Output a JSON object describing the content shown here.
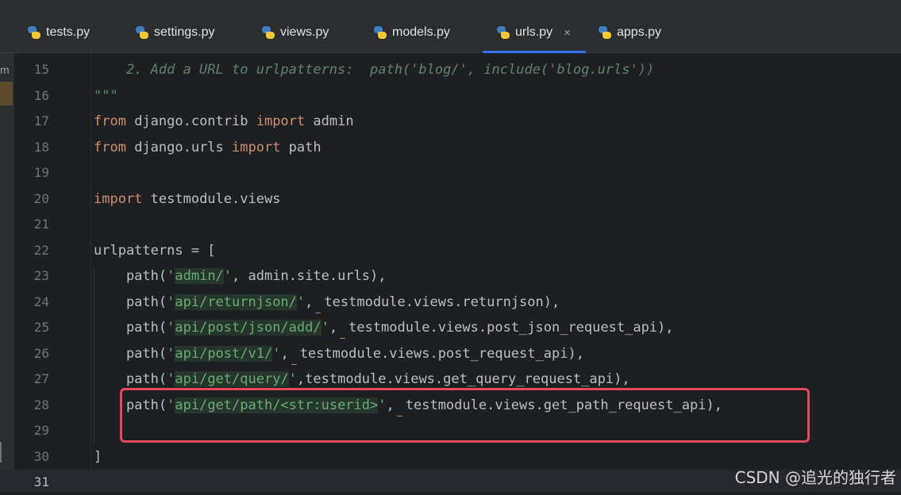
{
  "tabs": [
    {
      "label": "tests.py",
      "icon": "python-file-icon",
      "active": false
    },
    {
      "label": "settings.py",
      "icon": "python-file-icon",
      "active": false
    },
    {
      "label": "views.py",
      "icon": "python-file-icon",
      "active": false
    },
    {
      "label": "models.py",
      "icon": "python-file-icon",
      "active": false
    },
    {
      "label": "urls.py",
      "icon": "python-file-icon",
      "active": true
    },
    {
      "label": "apps.py",
      "icon": "python-file-icon",
      "active": false
    }
  ],
  "tab_close_glyph": "×",
  "left_strip_label": "m",
  "lines": [
    {
      "n": "15",
      "tokens": [
        {
          "t": "    2. Add a URL to urlpatterns:  path('blog/', include('blog.urls'))",
          "c": "cm"
        }
      ]
    },
    {
      "n": "16",
      "tokens": [
        {
          "t": "\"\"\"",
          "c": "cm"
        }
      ]
    },
    {
      "n": "17",
      "tokens": [
        {
          "t": "from",
          "c": "kw"
        },
        {
          "t": " django.contrib ",
          "c": ""
        },
        {
          "t": "import",
          "c": "kw"
        },
        {
          "t": " admin",
          "c": ""
        }
      ]
    },
    {
      "n": "18",
      "tokens": [
        {
          "t": "from",
          "c": "kw"
        },
        {
          "t": " django.urls ",
          "c": ""
        },
        {
          "t": "import",
          "c": "kw"
        },
        {
          "t": " path",
          "c": ""
        }
      ]
    },
    {
      "n": "19",
      "tokens": []
    },
    {
      "n": "20",
      "tokens": [
        {
          "t": "import",
          "c": "kw"
        },
        {
          "t": " testmodule.views",
          "c": ""
        }
      ]
    },
    {
      "n": "21",
      "tokens": []
    },
    {
      "n": "22",
      "tokens": [
        {
          "t": "urlpatterns = [",
          "c": ""
        }
      ]
    },
    {
      "n": "23",
      "tokens": [
        {
          "t": "    path(",
          "c": ""
        },
        {
          "t": "'",
          "c": "str"
        },
        {
          "t": "admin/",
          "c": "strhl"
        },
        {
          "t": "'",
          "c": "str"
        },
        {
          "t": ", admin.site.urls),",
          "c": ""
        }
      ]
    },
    {
      "n": "24",
      "tokens": [
        {
          "t": "    path(",
          "c": ""
        },
        {
          "t": "'",
          "c": "str"
        },
        {
          "t": "api/returnjson/",
          "c": "strhl"
        },
        {
          "t": "'",
          "c": "str"
        },
        {
          "t": ",",
          "c": "ws"
        },
        {
          "t": "testmodule.views.returnjson),",
          "c": ""
        }
      ]
    },
    {
      "n": "25",
      "tokens": [
        {
          "t": "    path(",
          "c": ""
        },
        {
          "t": "'",
          "c": "str"
        },
        {
          "t": "api/post/json/add/",
          "c": "strhl"
        },
        {
          "t": "'",
          "c": "str"
        },
        {
          "t": ",",
          "c": "ws"
        },
        {
          "t": "testmodule.views.post_json_request_api),",
          "c": ""
        }
      ]
    },
    {
      "n": "26",
      "tokens": [
        {
          "t": "    path(",
          "c": ""
        },
        {
          "t": "'",
          "c": "str"
        },
        {
          "t": "api/post/v1/",
          "c": "strhl"
        },
        {
          "t": "'",
          "c": "str"
        },
        {
          "t": ",",
          "c": "ws"
        },
        {
          "t": "testmodule.views.post_request_api),",
          "c": ""
        }
      ]
    },
    {
      "n": "27",
      "tokens": [
        {
          "t": "    path(",
          "c": ""
        },
        {
          "t": "'",
          "c": "str"
        },
        {
          "t": "api/get/query/",
          "c": "strhl"
        },
        {
          "t": "'",
          "c": "str"
        },
        {
          "t": ",testmodule.views.get_query_request_api),",
          "c": ""
        }
      ]
    },
    {
      "n": "28",
      "tokens": [
        {
          "t": "    path(",
          "c": ""
        },
        {
          "t": "'",
          "c": "str"
        },
        {
          "t": "api/get/path/<str:userid>",
          "c": "strhl"
        },
        {
          "t": "'",
          "c": "str"
        },
        {
          "t": ",",
          "c": "ws"
        },
        {
          "t": "testmodule.views.get_path_request_api),",
          "c": ""
        }
      ]
    },
    {
      "n": "29",
      "tokens": []
    },
    {
      "n": "30",
      "tokens": [
        {
          "t": "]",
          "c": ""
        }
      ]
    },
    {
      "n": "31",
      "tokens": []
    }
  ],
  "current_line": "31",
  "watermark": "CSDN @追光的独行者",
  "colors": {
    "keyword": "#cf8e6d",
    "comment": "#5f826b",
    "string": "#6aab73",
    "highlight_box": "#e5495e",
    "tab_underline": "#3574f0"
  }
}
